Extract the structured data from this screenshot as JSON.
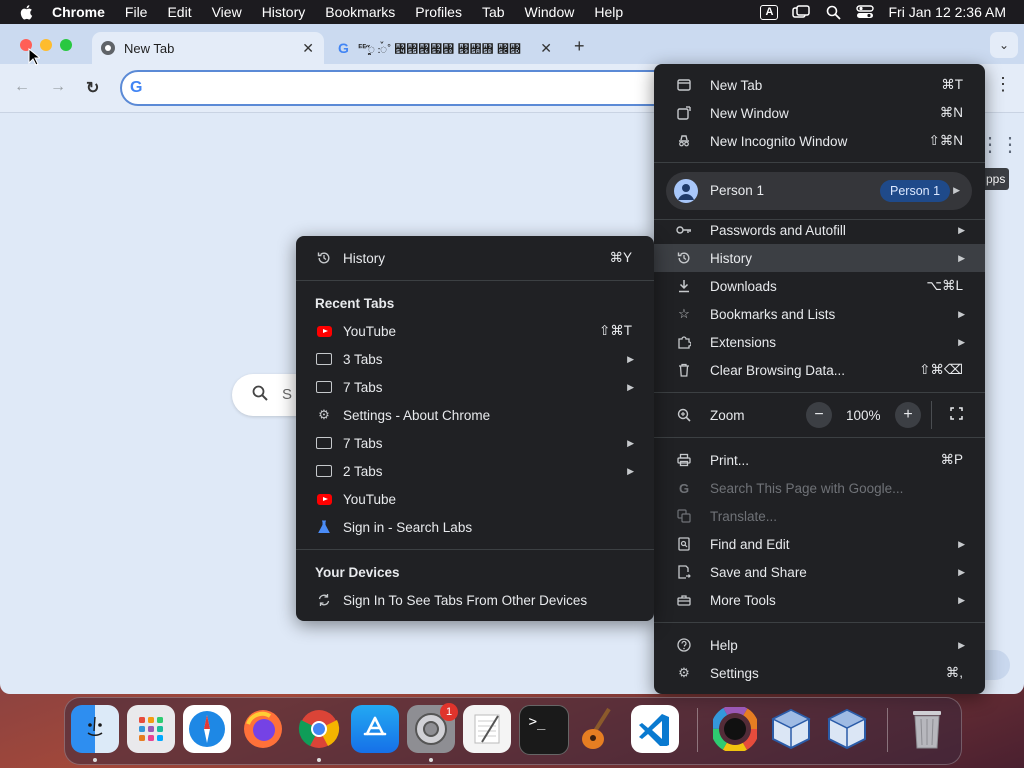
{
  "menubar": {
    "app": "Chrome",
    "items": [
      "File",
      "Edit",
      "View",
      "History",
      "Bookmarks",
      "Profiles",
      "Tab",
      "Window",
      "Help"
    ],
    "input_indicator": "A",
    "clock": "Fri Jan 12  2:36 AM"
  },
  "tabs": [
    {
      "title": "New Tab",
      "close": "✕"
    },
    {
      "title": "ꥹꥍꥌꥏꥐ ꥑꥒ꥓ ꥔꥕꥖꥗꥘ ꥙꥚꥛ ꥜꥝",
      "close": "✕"
    }
  ],
  "toolbar": {
    "new_tab": "+",
    "back": "←",
    "forward": "→",
    "reload": "↻",
    "google_g": "G",
    "menu": "⋮",
    "tab_search": "⌄"
  },
  "page": {
    "apps_tooltip": "pps",
    "search_placeholder": "S",
    "customize": "e"
  },
  "main_menu": {
    "items": [
      {
        "label": "New Tab",
        "shortcut": "⌘T",
        "icon": "new-tab-icon"
      },
      {
        "label": "New Window",
        "shortcut": "⌘N",
        "icon": "new-window-icon"
      },
      {
        "label": "New Incognito Window",
        "shortcut": "⇧⌘N",
        "icon": "incognito-icon"
      }
    ],
    "person": {
      "name": "Person 1",
      "badge": "Person 1"
    },
    "items2": [
      {
        "label": "Passwords and Autofill",
        "icon": "key-icon"
      },
      {
        "label": "History",
        "icon": "history-icon"
      },
      {
        "label": "Downloads",
        "shortcut": "⌥⌘L",
        "icon": "download-icon"
      },
      {
        "label": "Bookmarks and Lists",
        "icon": "star-icon"
      },
      {
        "label": "Extensions",
        "icon": "puzzle-icon"
      },
      {
        "label": "Clear Browsing Data...",
        "shortcut": "⇧⌘⌫",
        "icon": "trash-icon"
      }
    ],
    "zoom": {
      "label": "Zoom",
      "value": "100%",
      "minus": "−",
      "plus": "+"
    },
    "items3": [
      {
        "label": "Print...",
        "shortcut": "⌘P",
        "icon": "print-icon"
      },
      {
        "label": "Search This Page with Google...",
        "icon": "google-icon"
      },
      {
        "label": "Translate...",
        "icon": "translate-icon"
      },
      {
        "label": "Find and Edit",
        "icon": "find-icon"
      },
      {
        "label": "Save and Share",
        "icon": "save-share-icon"
      },
      {
        "label": "More Tools",
        "icon": "toolbox-icon"
      }
    ],
    "items4": [
      {
        "label": "Help",
        "icon": "help-icon"
      },
      {
        "label": "Settings",
        "shortcut": "⌘,",
        "icon": "settings-icon"
      }
    ]
  },
  "history_menu": {
    "title": "History",
    "shortcut": "⌘Y",
    "recent_header": "Recent Tabs",
    "recent": [
      {
        "label": "YouTube",
        "shortcut": "⇧⌘T",
        "icon": "youtube-icon"
      },
      {
        "label": "3 Tabs",
        "icon": "window-icon"
      },
      {
        "label": "7 Tabs",
        "icon": "window-icon"
      },
      {
        "label": "Settings - About Chrome",
        "icon": "settings-icon"
      },
      {
        "label": "7 Tabs",
        "icon": "window-icon"
      },
      {
        "label": "2 Tabs",
        "icon": "window-icon"
      },
      {
        "label": "YouTube",
        "icon": "youtube-icon"
      },
      {
        "label": "Sign in - Search Labs",
        "icon": "flask-icon"
      }
    ],
    "devices_header": "Your Devices",
    "devices_item": "Sign In To See Tabs From Other Devices"
  },
  "dock": {
    "badge": "1",
    "apps": [
      "Finder",
      "Launchpad",
      "Safari",
      "Firefox",
      "Chrome",
      "App Store",
      "System Settings",
      "TextEdit",
      "Terminal",
      "GarageBand",
      "Visual Studio Code",
      "Color Wheel",
      "VirtualBox",
      "VirtualBox VM",
      "Trash"
    ]
  }
}
